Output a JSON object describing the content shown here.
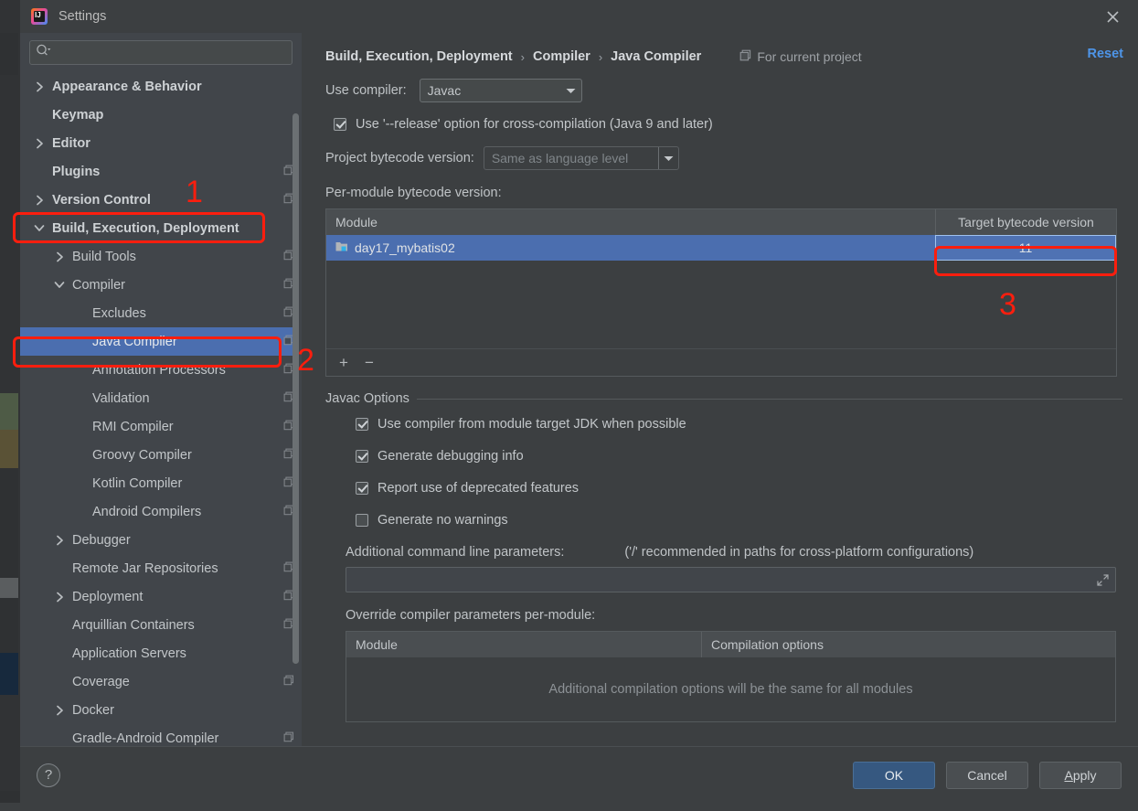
{
  "window": {
    "title": "Settings",
    "logo_text": "IJ",
    "close_icon": "close-icon"
  },
  "sidebar": {
    "search": {
      "placeholder": "",
      "value": "",
      "icon": "search-icon"
    },
    "items": [
      {
        "label": "Appearance & Behavior",
        "indent": 0,
        "twisty": "collapsed",
        "bold": true,
        "project_icon": false,
        "selected": false
      },
      {
        "label": "Keymap",
        "indent": 0,
        "twisty": "none",
        "bold": true,
        "project_icon": false,
        "selected": false
      },
      {
        "label": "Editor",
        "indent": 0,
        "twisty": "collapsed",
        "bold": true,
        "project_icon": false,
        "selected": false
      },
      {
        "label": "Plugins",
        "indent": 0,
        "twisty": "none",
        "bold": true,
        "project_icon": true,
        "selected": false
      },
      {
        "label": "Version Control",
        "indent": 0,
        "twisty": "collapsed",
        "bold": true,
        "project_icon": true,
        "selected": false
      },
      {
        "label": "Build, Execution, Deployment",
        "indent": 0,
        "twisty": "expanded",
        "bold": true,
        "project_icon": false,
        "selected": false
      },
      {
        "label": "Build Tools",
        "indent": 1,
        "twisty": "collapsed",
        "bold": false,
        "project_icon": true,
        "selected": false
      },
      {
        "label": "Compiler",
        "indent": 1,
        "twisty": "expanded",
        "bold": false,
        "project_icon": true,
        "selected": false
      },
      {
        "label": "Excludes",
        "indent": 2,
        "twisty": "none",
        "bold": false,
        "project_icon": true,
        "selected": false
      },
      {
        "label": "Java Compiler",
        "indent": 2,
        "twisty": "none",
        "bold": false,
        "project_icon": true,
        "selected": true
      },
      {
        "label": "Annotation Processors",
        "indent": 2,
        "twisty": "none",
        "bold": false,
        "project_icon": true,
        "selected": false
      },
      {
        "label": "Validation",
        "indent": 2,
        "twisty": "none",
        "bold": false,
        "project_icon": true,
        "selected": false
      },
      {
        "label": "RMI Compiler",
        "indent": 2,
        "twisty": "none",
        "bold": false,
        "project_icon": true,
        "selected": false
      },
      {
        "label": "Groovy Compiler",
        "indent": 2,
        "twisty": "none",
        "bold": false,
        "project_icon": true,
        "selected": false
      },
      {
        "label": "Kotlin Compiler",
        "indent": 2,
        "twisty": "none",
        "bold": false,
        "project_icon": true,
        "selected": false
      },
      {
        "label": "Android Compilers",
        "indent": 2,
        "twisty": "none",
        "bold": false,
        "project_icon": true,
        "selected": false
      },
      {
        "label": "Debugger",
        "indent": 1,
        "twisty": "collapsed",
        "bold": false,
        "project_icon": false,
        "selected": false
      },
      {
        "label": "Remote Jar Repositories",
        "indent": 1,
        "twisty": "none",
        "bold": false,
        "project_icon": true,
        "selected": false
      },
      {
        "label": "Deployment",
        "indent": 1,
        "twisty": "collapsed",
        "bold": false,
        "project_icon": true,
        "selected": false
      },
      {
        "label": "Arquillian Containers",
        "indent": 1,
        "twisty": "none",
        "bold": false,
        "project_icon": true,
        "selected": false
      },
      {
        "label": "Application Servers",
        "indent": 1,
        "twisty": "none",
        "bold": false,
        "project_icon": false,
        "selected": false
      },
      {
        "label": "Coverage",
        "indent": 1,
        "twisty": "none",
        "bold": false,
        "project_icon": true,
        "selected": false
      },
      {
        "label": "Docker",
        "indent": 1,
        "twisty": "collapsed",
        "bold": false,
        "project_icon": false,
        "selected": false
      },
      {
        "label": "Gradle-Android Compiler",
        "indent": 1,
        "twisty": "none",
        "bold": false,
        "project_icon": true,
        "selected": false
      }
    ]
  },
  "header": {
    "breadcrumb": [
      "Build, Execution, Deployment",
      "Compiler",
      "Java Compiler"
    ],
    "separator": "›",
    "scope_label": "For current project",
    "scope_icon": "project-scope-icon",
    "reset_label": "Reset"
  },
  "main": {
    "use_compiler": {
      "label": "Use compiler:",
      "value": "Javac"
    },
    "release_option": {
      "label": "Use '--release' option for cross-compilation (Java 9 and later)",
      "checked": true
    },
    "project_bytecode": {
      "label": "Project bytecode version:",
      "value": "Same as language level",
      "disabled": true
    },
    "per_module_label": "Per-module bytecode version:",
    "module_table": {
      "columns": [
        "Module",
        "Target bytecode version"
      ],
      "rows": [
        {
          "module": "day17_mybatis02",
          "target": "11",
          "selected": true
        }
      ],
      "toolbar": {
        "add": "+",
        "remove": "−"
      }
    },
    "javac_options": {
      "title": "Javac Options",
      "checkboxes": [
        {
          "label": "Use compiler from module target JDK when possible",
          "checked": true
        },
        {
          "label": "Generate debugging info",
          "checked": true
        },
        {
          "label": "Report use of deprecated features",
          "checked": true
        },
        {
          "label": "Generate no warnings",
          "checked": false
        }
      ],
      "additional_params_label": "Additional command line parameters:",
      "additional_params_hint": "('/' recommended in paths for cross-platform configurations)",
      "additional_params_value": "",
      "additional_params_placeholder": "",
      "override_label": "Override compiler parameters per-module:",
      "override_table": {
        "columns": [
          "Module",
          "Compilation options"
        ],
        "empty_message": "Additional compilation options will be the same for all modules"
      }
    }
  },
  "footer": {
    "help_label": "?",
    "ok_label": "OK",
    "cancel_label": "Cancel",
    "apply_label": "Apply",
    "apply_mnemonic": "A",
    "apply_rest": "pply"
  },
  "annotations": {
    "accent_color": "#fb1e0e",
    "markers": [
      {
        "number": "1",
        "for": "build-execution-deployment-node"
      },
      {
        "number": "2",
        "for": "java-compiler-node"
      },
      {
        "number": "3",
        "for": "target-bytecode-cell"
      }
    ]
  },
  "colors": {
    "selection_blue": "#4b6eaf",
    "accent_link": "#4e95e8",
    "primary_button": "#365880",
    "annotation_red": "#fb1e0e",
    "dialog_bg": "#3c3f41",
    "sidebar_bg": "#41454a"
  }
}
